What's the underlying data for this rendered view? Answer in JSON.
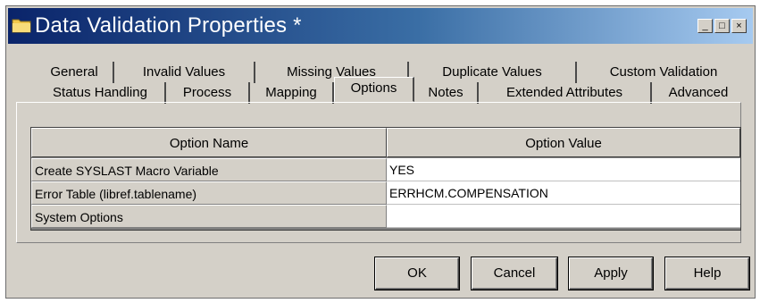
{
  "window": {
    "title": "Data Validation Properties *",
    "controls": {
      "minimize": "_",
      "maximize": "□",
      "close": "×"
    }
  },
  "tabs": {
    "row_back": [
      "General",
      "Invalid Values",
      "Missing Values",
      "Duplicate Values",
      "Custom Validation"
    ],
    "row_front": [
      "Status Handling",
      "Process",
      "Mapping",
      "Options",
      "Notes",
      "Extended Attributes",
      "Advanced"
    ],
    "active": "Options"
  },
  "options_table": {
    "headers": [
      "Option Name",
      "Option Value"
    ],
    "rows": [
      {
        "name": "Create SYSLAST Macro Variable",
        "value": "YES"
      },
      {
        "name": "Error Table (libref.tablename)",
        "value": "ERRHCM.COMPENSATION"
      },
      {
        "name": "System Options",
        "value": ""
      }
    ]
  },
  "buttons": {
    "ok": "OK",
    "cancel": "Cancel",
    "apply": "Apply",
    "help": "Help"
  },
  "colors": {
    "titlebar_start": "#0a246a",
    "titlebar_end": "#a6caf0",
    "face": "#d4d0c8"
  }
}
